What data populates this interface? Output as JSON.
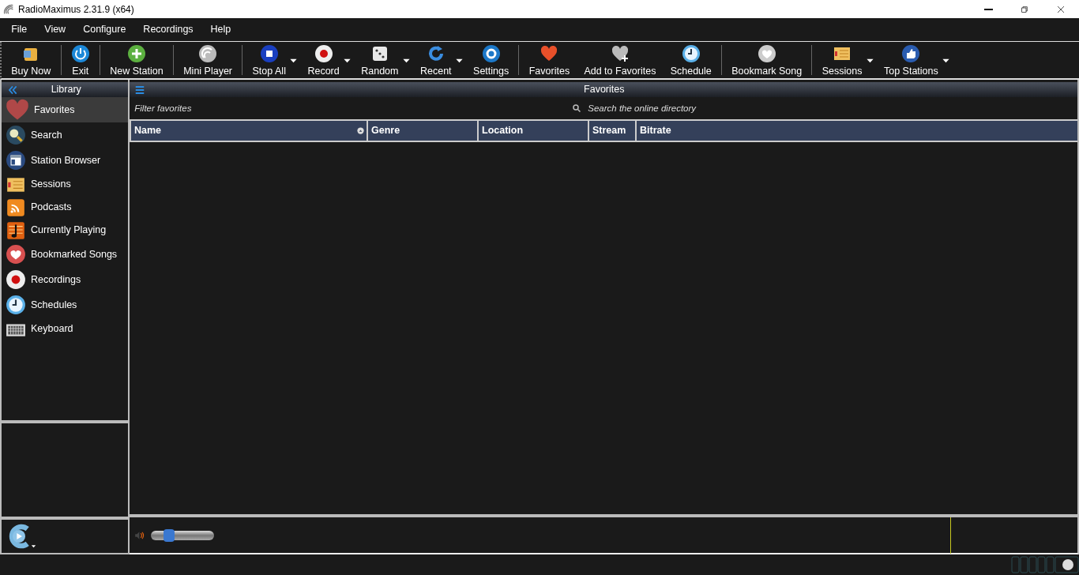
{
  "window": {
    "title": "RadioMaximus 2.31.9 (x64)"
  },
  "menu": [
    "File",
    "View",
    "Configure",
    "Recordings",
    "Help"
  ],
  "toolbar": {
    "groups": [
      [
        {
          "label": "Buy Now",
          "dropdown": false
        }
      ],
      [
        {
          "label": "Exit",
          "dropdown": false
        }
      ],
      [
        {
          "label": "New Station",
          "dropdown": false
        }
      ],
      [
        {
          "label": "Mini Player",
          "dropdown": false
        }
      ],
      [
        {
          "label": "Stop All",
          "dropdown": true
        },
        {
          "label": "Record",
          "dropdown": true
        },
        {
          "label": "Random",
          "dropdown": true
        },
        {
          "label": "Recent",
          "dropdown": true
        },
        {
          "label": "Settings",
          "dropdown": false
        }
      ],
      [
        {
          "label": "Favorites",
          "dropdown": false
        },
        {
          "label": "Add to Favorites",
          "dropdown": false
        },
        {
          "label": "Schedule",
          "dropdown": false
        }
      ],
      [
        {
          "label": "Bookmark Song",
          "dropdown": false
        }
      ],
      [
        {
          "label": "Sessions",
          "dropdown": true
        },
        {
          "label": "Top Stations",
          "dropdown": true
        }
      ]
    ]
  },
  "library": {
    "title": "Library",
    "items": [
      {
        "label": "Favorites",
        "selected": true
      },
      {
        "label": "Search",
        "selected": false
      },
      {
        "label": "Station Browser",
        "selected": false
      },
      {
        "label": "Sessions",
        "selected": false
      },
      {
        "label": "Podcasts",
        "selected": false
      },
      {
        "label": "Currently Playing",
        "selected": false
      },
      {
        "label": "Bookmarked Songs",
        "selected": false
      },
      {
        "label": "Recordings",
        "selected": false
      },
      {
        "label": "Schedules",
        "selected": false
      },
      {
        "label": "Keyboard",
        "selected": false
      }
    ]
  },
  "main": {
    "title": "Favorites",
    "filter": {
      "placeholder": "Filter favorites"
    },
    "online_search": {
      "placeholder": "Search the online directory"
    },
    "table": {
      "columns": [
        {
          "label": "Name",
          "sorted": true
        },
        {
          "label": "Genre",
          "sorted": false
        },
        {
          "label": "Location",
          "sorted": false
        },
        {
          "label": "Stream",
          "sorted": false
        },
        {
          "label": "Bitrate",
          "sorted": false
        }
      ]
    }
  },
  "player": {
    "volume": {
      "level": 0.25
    }
  }
}
